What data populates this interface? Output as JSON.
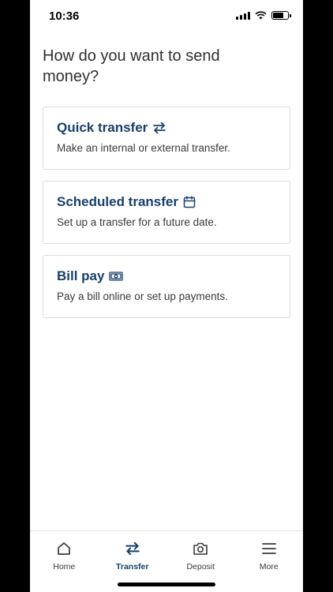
{
  "status_bar": {
    "time": "10:36",
    "battery_level": 0.7
  },
  "page_title": "How do you want to send money?",
  "options": [
    {
      "title": "Quick transfer",
      "icon": "transfer-arrows-icon",
      "description": "Make an internal or external transfer."
    },
    {
      "title": "Scheduled transfer",
      "icon": "calendar-icon",
      "description": "Set up a transfer for a future date."
    },
    {
      "title": "Bill pay",
      "icon": "cash-icon",
      "description": "Pay a bill online or set up payments."
    }
  ],
  "bottom_nav": {
    "items": [
      {
        "label": "Home",
        "icon": "home-icon"
      },
      {
        "label": "Transfer",
        "icon": "transfer-arrows-icon",
        "active": true
      },
      {
        "label": "Deposit",
        "icon": "camera-icon"
      },
      {
        "label": "More",
        "icon": "hamburger-menu-icon"
      }
    ]
  },
  "colors": {
    "brand": "#173f6b",
    "text": "#3a3a3a",
    "border": "#dcdcdc"
  }
}
